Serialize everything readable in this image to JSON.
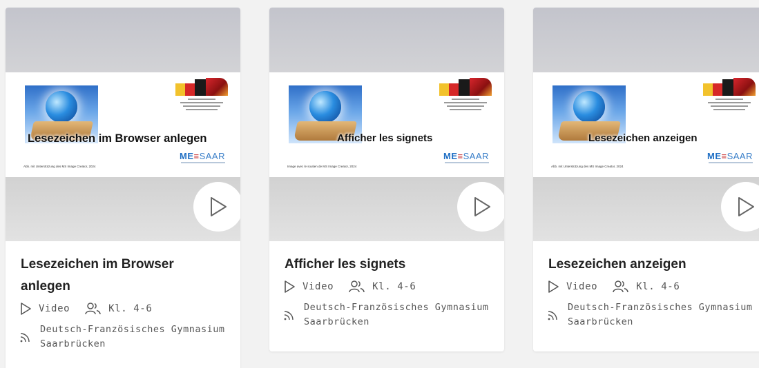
{
  "cards": [
    {
      "slide_title": "Lesezeichen im Browser anlegen",
      "slide_credit": "Abb. mit Unterstützung des MS Image Creator, 2024",
      "logo_me": "ME",
      "logo_saar": "SAAR",
      "title": "Lesezeichen im Browser anlegen",
      "type": "Video",
      "grade": "Kl. 4-6",
      "source": "Deutsch-Französisches Gymnasium Saarbrücken"
    },
    {
      "slide_title": "Afficher les signets",
      "slide_credit": "Image avec le soutien de MS Image Creator, 2024",
      "logo_me": "ME",
      "logo_saar": "SAAR",
      "title": "Afficher les signets",
      "type": "Video",
      "grade": "Kl. 4-6",
      "source": "Deutsch-Französisches Gymnasium Saarbrücken"
    },
    {
      "slide_title": "Lesezeichen anzeigen",
      "slide_credit": "Abb. mit Unterstützung des MS Image Creator, 2024",
      "logo_me": "ME",
      "logo_saar": "SAAR",
      "title": "Lesezeichen anzeigen",
      "type": "Video",
      "grade": "Kl. 4-6",
      "source": "Deutsch-Französisches Gymnasium Saarbrücken"
    }
  ],
  "icons": {
    "play": "play-icon",
    "video": "video-type-icon",
    "grade": "users-icon",
    "source": "rss-feed-icon"
  },
  "colors": {
    "accent_text": "#222222",
    "meta_text": "#555555",
    "logo_blue": "#1f6fc4",
    "logo_red": "#c62828"
  }
}
